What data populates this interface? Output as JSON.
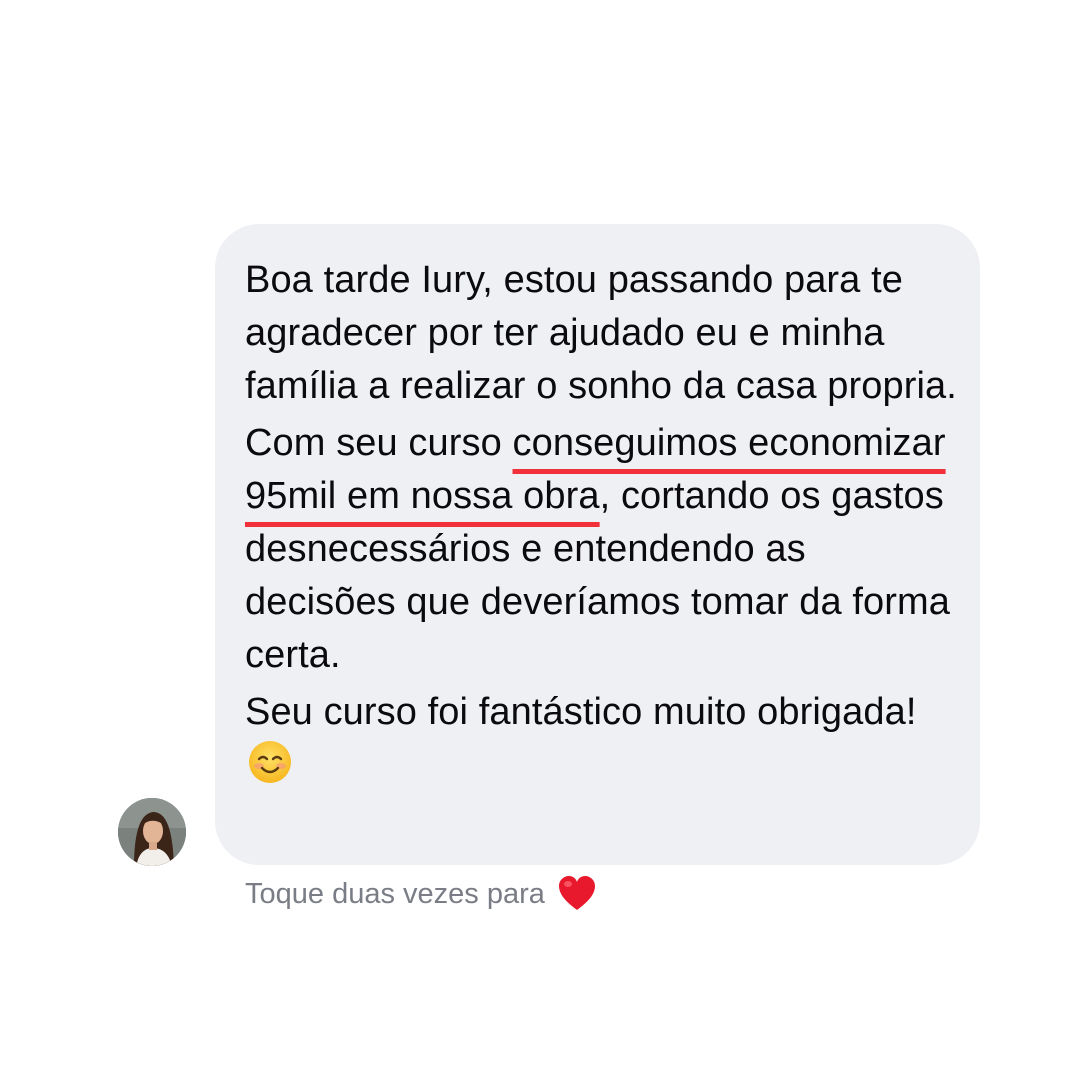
{
  "message": {
    "paragraph_1": "Boa tarde Iury, estou passando para te agradecer por ter ajudado eu e minha família a realizar o sonho da casa propria.",
    "paragraph_2_before": "Com seu curso ",
    "paragraph_2_highlight": "conseguimos economizar 95mil em nossa obra",
    "paragraph_2_after": ", cortando os gastos desnecessários e entendendo as decisões que deveríamos tomar da forma certa.",
    "paragraph_3": "Seu curso foi fantástico muito obrigada!",
    "emoji": "smiling-face-icon",
    "highlight_color": "#f2303a",
    "bubble_color": "#eff0f4"
  },
  "reaction_hint": {
    "label": "Toque duas vezes para",
    "icon": "heart-icon",
    "icon_color": "#e8192c"
  },
  "sender": {
    "avatar": "avatar"
  }
}
